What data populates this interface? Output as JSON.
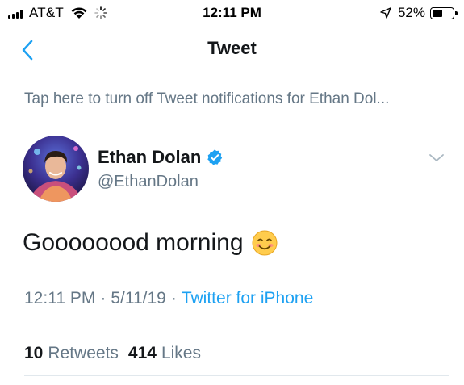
{
  "status_bar": {
    "carrier": "AT&T",
    "time": "12:11 PM",
    "battery_percent": "52%",
    "battery_level": 0.52,
    "icons": [
      "signal-icon",
      "wifi-icon",
      "activity-spinner-icon",
      "location-arrow-icon",
      "battery-icon"
    ]
  },
  "nav": {
    "title": "Tweet",
    "back_icon": "chevron-left-icon",
    "accent_color": "#1da1f2"
  },
  "notification": {
    "text": "Tap here to turn off Tweet notifications for Ethan Dol..."
  },
  "tweet": {
    "author": {
      "name": "Ethan Dolan",
      "handle": "@EthanDolan",
      "verified": true
    },
    "text": "Goooooood morning",
    "emoji": "smiling-face-icon",
    "time": "12:11 PM",
    "date": "5/11/19",
    "separator": "·",
    "source": "Twitter for iPhone",
    "stats": {
      "retweets_count": "10",
      "retweets_label": "Retweets",
      "likes_count": "414",
      "likes_label": "Likes"
    }
  },
  "colors": {
    "text_primary": "#14171a",
    "text_secondary": "#657786",
    "link": "#1da1f2",
    "divider": "#e1e8ed"
  }
}
